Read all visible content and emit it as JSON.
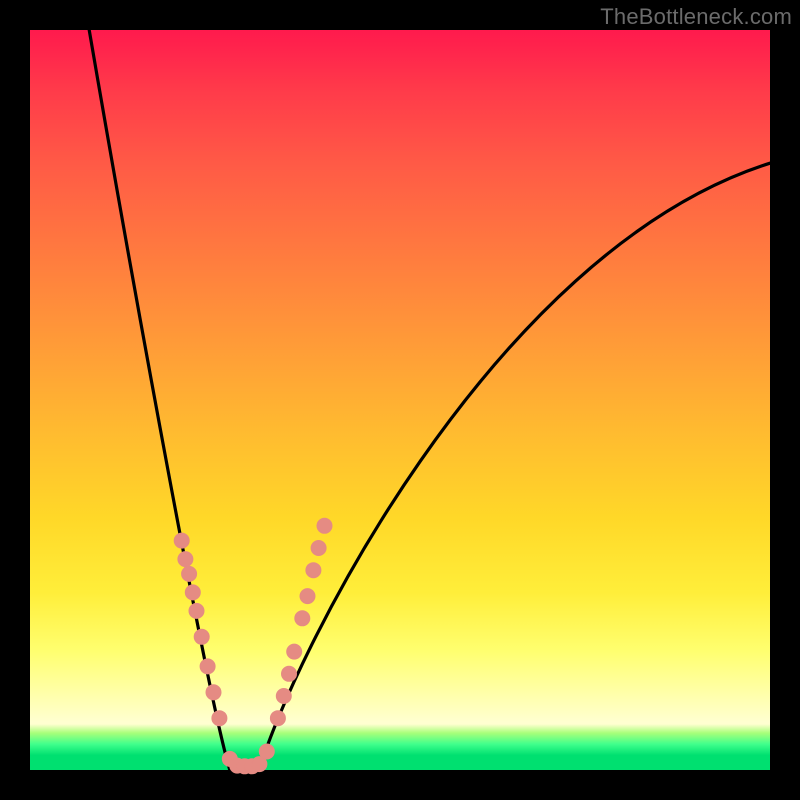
{
  "watermark": "TheBottleneck.com",
  "chart_data": {
    "type": "line",
    "title": "",
    "xlabel": "",
    "ylabel": "",
    "xlim": [
      0,
      100
    ],
    "ylim": [
      0,
      100
    ],
    "curve": {
      "left_top_x": 8,
      "left_top_y": 100,
      "min_x": 27,
      "min_y": 0,
      "flat_to_x": 31,
      "right_top_x": 100,
      "right_top_y": 82
    },
    "series": [
      {
        "name": "markers",
        "points": [
          {
            "x": 20.5,
            "y": 31
          },
          {
            "x": 21.0,
            "y": 28.5
          },
          {
            "x": 21.5,
            "y": 26.5
          },
          {
            "x": 22.0,
            "y": 24
          },
          {
            "x": 22.5,
            "y": 21.5
          },
          {
            "x": 23.2,
            "y": 18
          },
          {
            "x": 24.0,
            "y": 14
          },
          {
            "x": 24.8,
            "y": 10.5
          },
          {
            "x": 25.6,
            "y": 7
          },
          {
            "x": 27.0,
            "y": 1.5
          },
          {
            "x": 28.0,
            "y": 0.6
          },
          {
            "x": 29.0,
            "y": 0.5
          },
          {
            "x": 30.0,
            "y": 0.5
          },
          {
            "x": 31.0,
            "y": 0.8
          },
          {
            "x": 32.0,
            "y": 2.5
          },
          {
            "x": 33.5,
            "y": 7
          },
          {
            "x": 34.3,
            "y": 10
          },
          {
            "x": 35.0,
            "y": 13
          },
          {
            "x": 35.7,
            "y": 16
          },
          {
            "x": 36.8,
            "y": 20.5
          },
          {
            "x": 37.5,
            "y": 23.5
          },
          {
            "x": 38.3,
            "y": 27
          },
          {
            "x": 39.0,
            "y": 30
          },
          {
            "x": 39.8,
            "y": 33
          }
        ]
      }
    ],
    "gradient_stops": [
      {
        "pos": 0,
        "color": "#ff1a4d"
      },
      {
        "pos": 50,
        "color": "#ffb030"
      },
      {
        "pos": 85,
        "color": "#ffff90"
      },
      {
        "pos": 97,
        "color": "#30f080"
      },
      {
        "pos": 100,
        "color": "#00e070"
      }
    ]
  }
}
